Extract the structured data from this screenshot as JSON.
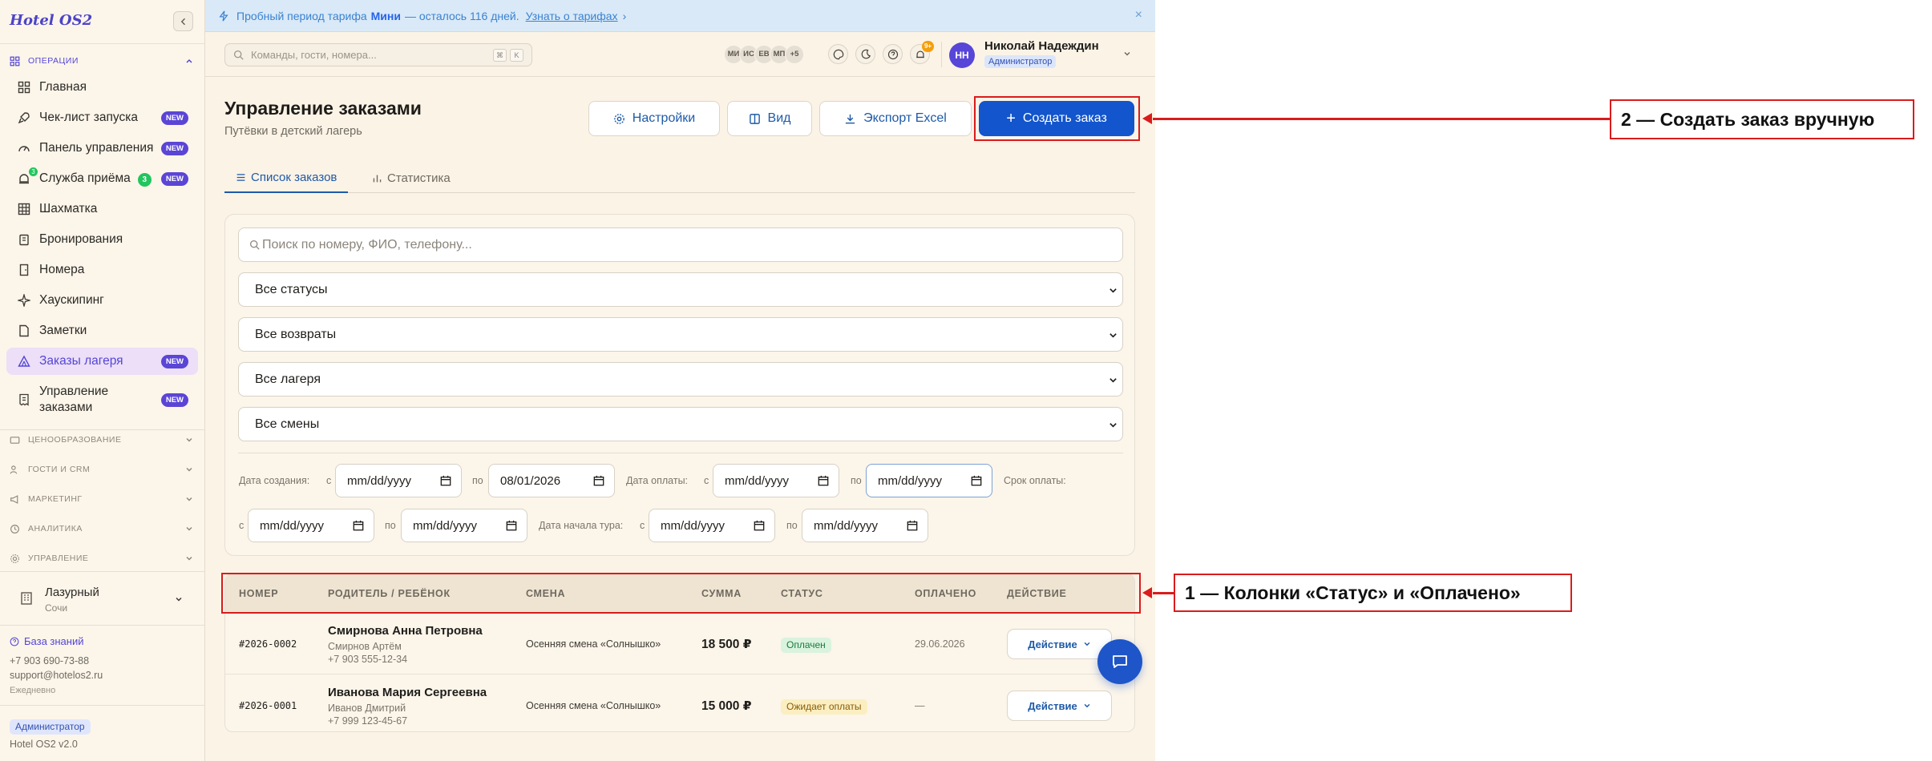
{
  "sidebar": {
    "brand": "Hotel OS2",
    "group_operations": "ОПЕРАЦИИ",
    "items": [
      {
        "label": "Главная"
      },
      {
        "label": "Чек-лист запуска",
        "badge": "NEW"
      },
      {
        "label": "Панель управления",
        "badge": "NEW"
      },
      {
        "label": "Служба приёма",
        "count": "3",
        "icon_count": "3",
        "badge": "NEW"
      },
      {
        "label": "Шахматка"
      },
      {
        "label": "Бронирования"
      },
      {
        "label": "Номера"
      },
      {
        "label": "Хаускипинг"
      },
      {
        "label": "Заметки"
      },
      {
        "label": "Заказы лагеря",
        "badge": "NEW"
      },
      {
        "label": "Управление заказами",
        "badge": "NEW"
      }
    ],
    "groups": [
      "ЦЕНООБРАЗОВАНИЕ",
      "ГОСТИ И CRM",
      "МАРКЕТИНГ",
      "АНАЛИТИКА",
      "УПРАВЛЕНИЕ"
    ],
    "hotel_name": "Лазурный",
    "hotel_city": "Сочи",
    "kb_link": "База знаний",
    "phone": "+7 903 690-73-88",
    "email": "support@hotelos2.ru",
    "schedule": "Ежедневно",
    "role": "Администратор",
    "version": "Hotel OS2 v2.0"
  },
  "promo": {
    "text_before": "Пробный период тарифа",
    "plan": "Мини",
    "text_after": "— осталось 116 дней.",
    "link": "Узнать о тарифах",
    "link_arrow": "›",
    "close": "×"
  },
  "topbar": {
    "search_placeholder": "Команды, гости, номера...",
    "kbd1": "⌘",
    "kbd2": "K",
    "avatars": [
      "МИ",
      "ИС",
      "ЕВ",
      "МП",
      "+5"
    ],
    "notif_count": "9+",
    "user_initials": "НН",
    "user_name": "Николай Надеждин",
    "user_role": "Администратор"
  },
  "page": {
    "title": "Управление заказами",
    "subtitle": "Путёвки в детский лагерь",
    "btn_settings": "Настройки",
    "btn_view": "Вид",
    "btn_export": "Экспорт Excel",
    "btn_create": "Создать заказ",
    "btn_create_plus": "+",
    "tab_list": "Список заказов",
    "tab_stats": "Статистика"
  },
  "filters": {
    "search_placeholder": "Поиск по номеру, ФИО, телефону...",
    "status": "Все статусы",
    "refunds": "Все возвраты",
    "camps": "Все лагеря",
    "shifts": "Все смены",
    "created_label": "Дата создания:",
    "paid_label": "Дата оплаты:",
    "deadline_label": "Срок оплаты:",
    "tour_start_label": "Дата начала тура:",
    "from": "с",
    "to": "по",
    "date_placeholder": "mm/dd/yyyy",
    "created_to_value": "08/01/2026"
  },
  "table": {
    "headers": [
      "НОМЕР",
      "РОДИТЕЛЬ / РЕБЁНОК",
      "СМЕНА",
      "СУММА",
      "СТАТУС",
      "ОПЛАЧЕНО",
      "ДЕЙСТВИЕ"
    ],
    "rows": [
      {
        "number": "#2026-0002",
        "parent": "Смирнова Анна Петровна",
        "child": "Смирнов Артём",
        "phone": "+7 903 555-12-34",
        "shift": "Осенняя смена «Солнышко»",
        "sum": "18 500 ₽",
        "status": "Оплачен",
        "paid": "29.06.2026",
        "action": "Действие"
      },
      {
        "number": "#2026-0001",
        "parent": "Иванова Мария Сергеевна",
        "child": "Иванов Дмитрий",
        "phone": "+7 999 123-45-67",
        "shift": "Осенняя смена «Солнышко»",
        "sum": "15 000 ₽",
        "status": "Ожидает оплаты",
        "paid": "—",
        "action": "Действие"
      }
    ]
  },
  "annotations": {
    "callout1": "1 — Колонки «Статус» и «Оплачено»",
    "callout2": "2 — Создать заказ вручную"
  },
  "colors": {
    "accent": "#1255cc",
    "brand": "#5446d6",
    "annotation": "#d91c1c",
    "paid_badge": "#d9f3df",
    "waiting_badge": "#fbefc1"
  },
  "icons": {
    "sidebar": [
      "grid-icon",
      "rocket-icon",
      "gauge-icon",
      "bell-icon",
      "table-icon",
      "clipboard-icon",
      "door-icon",
      "sparkle-icon",
      "note-icon",
      "tent-icon",
      "receipt-icon"
    ]
  }
}
